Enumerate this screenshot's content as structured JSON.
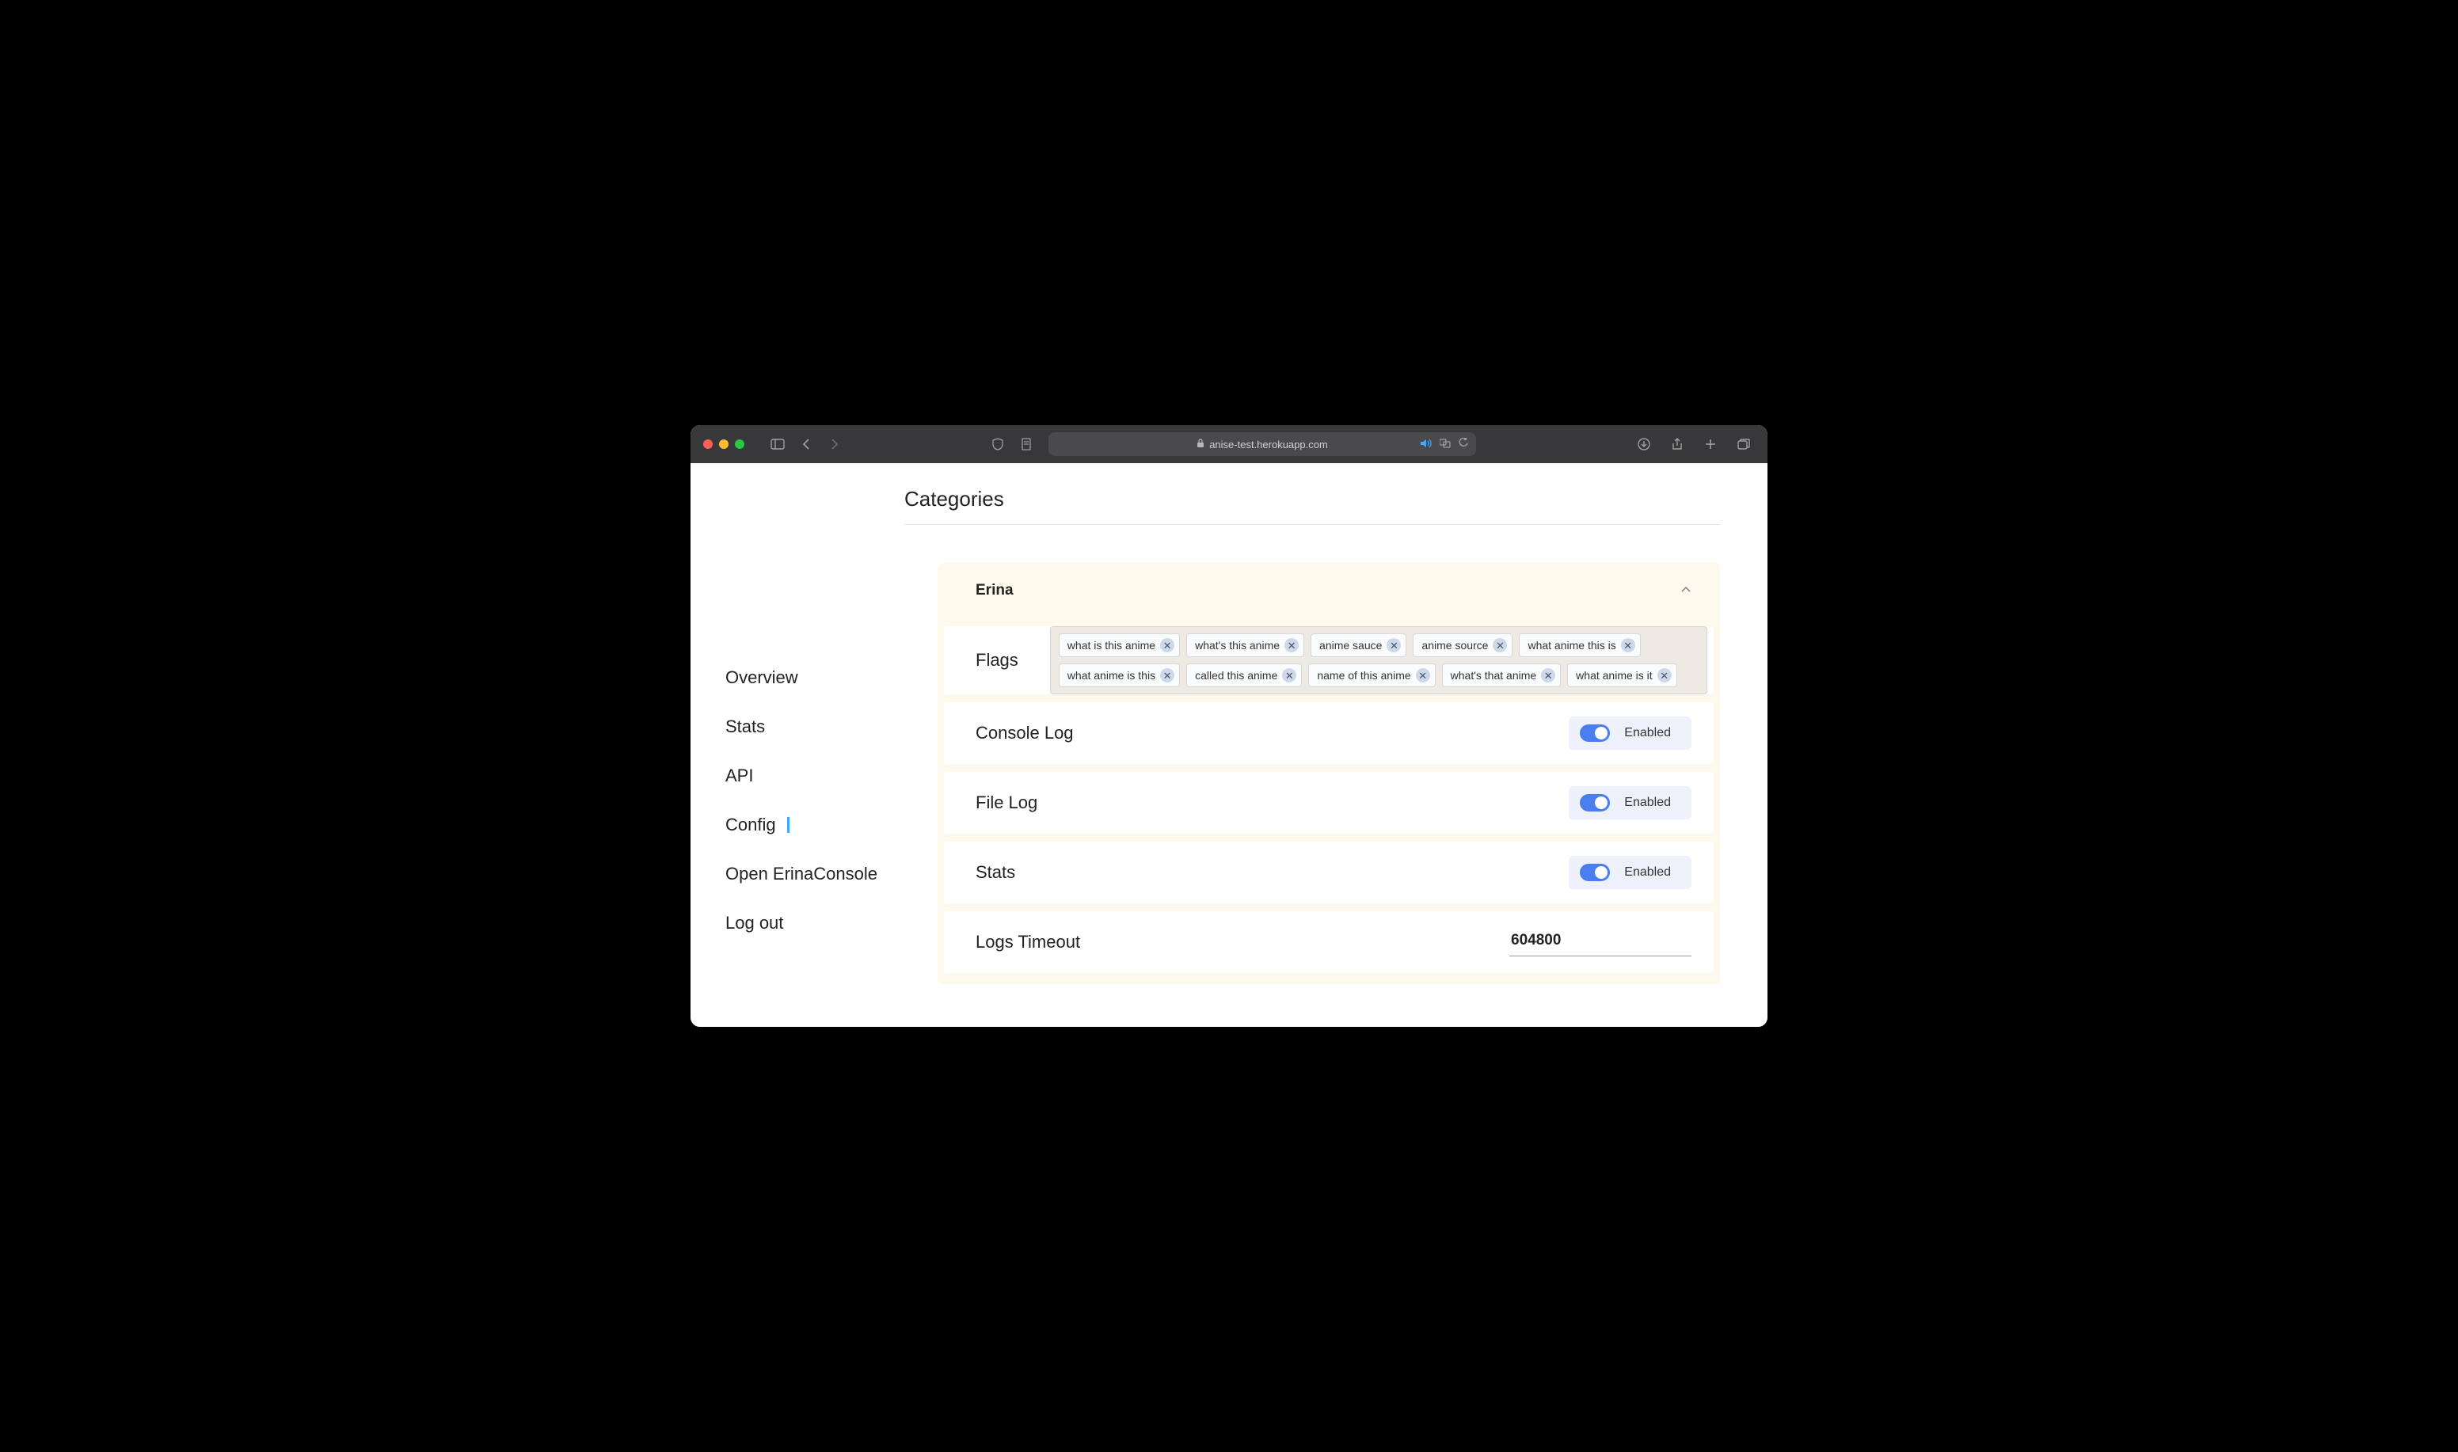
{
  "browser": {
    "url": "anise-test.herokuapp.com"
  },
  "sidebar": {
    "items": [
      {
        "label": "Overview",
        "active": false
      },
      {
        "label": "Stats",
        "active": false
      },
      {
        "label": "API",
        "active": false
      },
      {
        "label": "Config",
        "active": true
      },
      {
        "label": "Open ErinaConsole",
        "active": false
      },
      {
        "label": "Log out",
        "active": false
      }
    ]
  },
  "page": {
    "title": "Categories"
  },
  "panel": {
    "title": "Erina",
    "rows": {
      "flags": {
        "label": "Flags",
        "tags": [
          "what is this anime",
          "what's this anime",
          "anime sauce",
          "anime source",
          "what anime this is",
          "what anime is this",
          "called this anime",
          "name of this anime",
          "what's that anime",
          "what anime is it"
        ]
      },
      "console_log": {
        "label": "Console Log",
        "state": "Enabled",
        "on": true
      },
      "file_log": {
        "label": "File Log",
        "state": "Enabled",
        "on": true
      },
      "stats": {
        "label": "Stats",
        "state": "Enabled",
        "on": true
      },
      "logs_timeout": {
        "label": "Logs Timeout",
        "value": "604800"
      }
    }
  }
}
